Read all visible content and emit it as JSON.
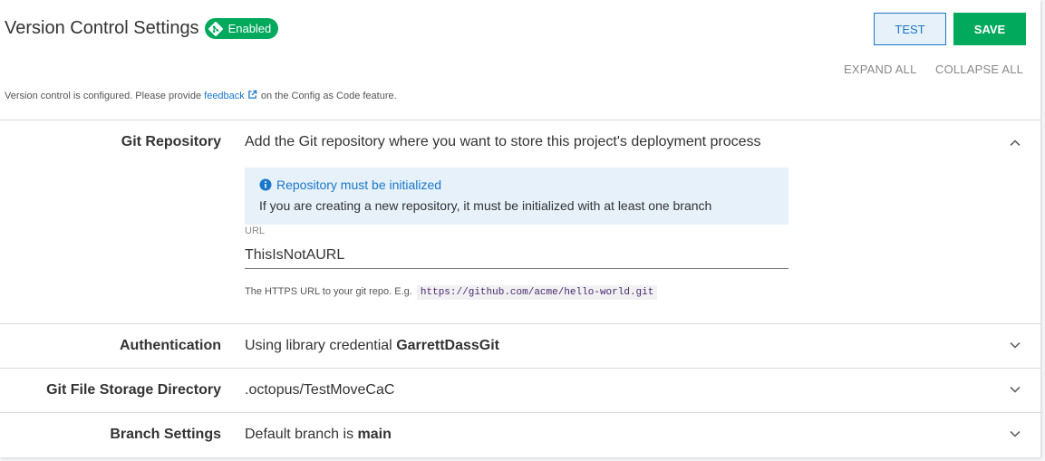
{
  "header": {
    "title": "Version Control Settings",
    "status_badge": "Enabled",
    "test_label": "TEST",
    "save_label": "SAVE",
    "expand_all": "EXPAND ALL",
    "collapse_all": "COLLAPSE ALL"
  },
  "notice": {
    "prefix": "Version control is configured. Please provide",
    "link": "feedback",
    "suffix": "on the Config as Code feature."
  },
  "sections": {
    "git_repository": {
      "label": "Git Repository",
      "summary": "Add the Git repository where you want to store this project's deployment process",
      "callout_title": "Repository must be initialized",
      "callout_body": "If you are creating a new repository, it must be initialized with at least one branch",
      "url_label": "URL",
      "url_value": "ThisIsNotAURL",
      "hint_text": "The HTTPS URL to your git repo. E.g.",
      "hint_example": "https://github.com/acme/hello-world.git"
    },
    "authentication": {
      "label": "Authentication",
      "summary_prefix": "Using library credential",
      "summary_value": "GarrettDassGit"
    },
    "storage": {
      "label": "Git File Storage Directory",
      "summary": ".octopus/TestMoveCaC"
    },
    "branch": {
      "label": "Branch Settings",
      "summary_prefix": "Default branch is",
      "summary_value": "main"
    }
  },
  "icons": {
    "badge": "git-icon",
    "feedback": "external-link-icon",
    "callout": "info-icon",
    "expanded": "chevron-up-icon",
    "collapsed": "chevron-down-icon"
  },
  "colors": {
    "accent": "#1a77ca",
    "success": "#00a95c",
    "info_background": "#e6f1fa"
  }
}
